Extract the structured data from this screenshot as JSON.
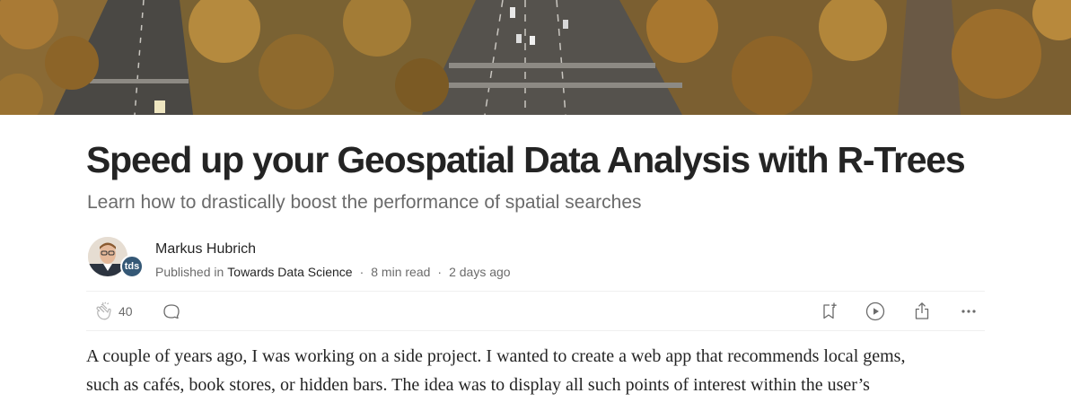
{
  "article": {
    "title": "Speed up your Geospatial Data Analysis with R-Trees",
    "subtitle": "Learn how to drastically boost the performance of spatial searches"
  },
  "author": {
    "name": "Markus Hubrich",
    "published_in_label": "Published in",
    "publication": "Towards Data Science",
    "badge": "tds",
    "read_time": "8 min read",
    "date": "2 days ago"
  },
  "actions": {
    "clap_count": "40",
    "icons": [
      "clap-icon",
      "comment-icon",
      "bookmark-icon",
      "play-icon",
      "share-icon",
      "more-icon"
    ]
  },
  "body": {
    "line1": "A couple of years ago, I was working on a side project. I wanted to create a web app that recommends local gems,",
    "line2": "such as cafés, book stores, or hidden bars. The idea was to display all such points of interest within the user’s"
  }
}
